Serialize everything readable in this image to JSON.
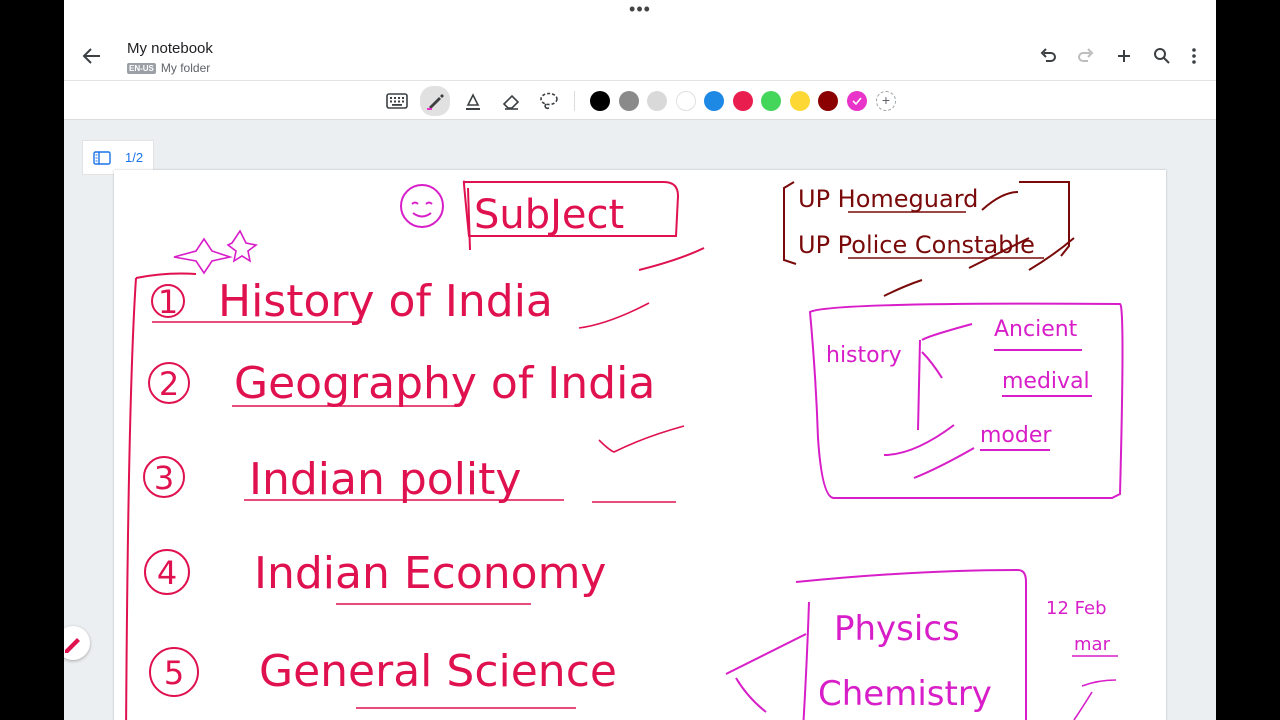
{
  "header": {
    "more_dots": "•••",
    "title": "My notebook",
    "lang_badge": "EN-US",
    "folder": "My folder"
  },
  "toolbar": {
    "tools": [
      "keyboard-icon",
      "pen-icon",
      "highlighter-icon",
      "eraser-icon",
      "lasso-select-icon"
    ],
    "active_tool": "pen",
    "colors": [
      "#000000",
      "#8a8a8a",
      "#d9d9d9",
      "#ffffff",
      "#1e88e5",
      "#e91e4f",
      "#43d65a",
      "#fdd835",
      "#8b0000",
      "#e834c8"
    ],
    "selected_color": "#e834c8",
    "add_color": "+"
  },
  "page_nav": {
    "page_indicator": "1/2"
  },
  "notes": {
    "subject": "SubJect",
    "list": [
      {
        "num": "1",
        "text": "History of India"
      },
      {
        "num": "2",
        "text": "Geography of India"
      },
      {
        "num": "3",
        "text": "Indian polity"
      },
      {
        "num": "4",
        "text": "Indian Economy"
      },
      {
        "num": "5",
        "text": "General Science"
      }
    ],
    "exams": [
      "UP Homeguard",
      "UP Police Constable"
    ],
    "history_box": {
      "label": "history",
      "branches": [
        "Ancient",
        "medival",
        "moder"
      ]
    },
    "science_box": [
      "Physics",
      "Chemistry"
    ],
    "side_note_1": "12 Feb",
    "side_note_2": "mar"
  },
  "colors": {
    "ink_red": "#e0114f",
    "ink_magenta": "#d81ec8",
    "ink_maroon": "#7a0a0a",
    "accent_blue": "#1a73e8"
  }
}
